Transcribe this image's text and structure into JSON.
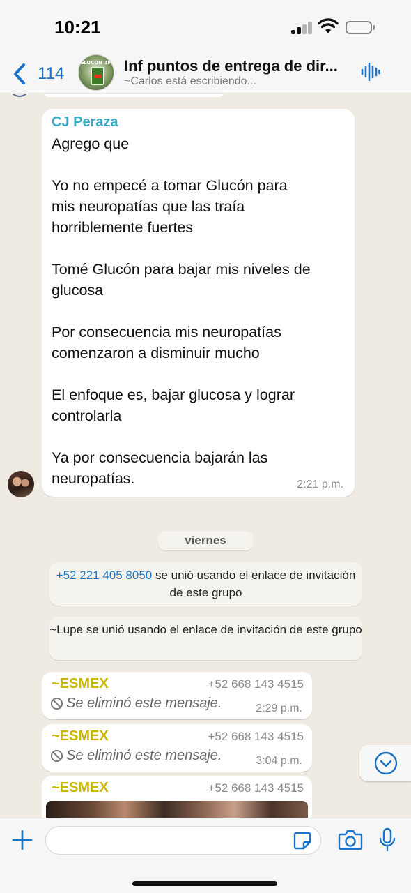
{
  "status_bar": {
    "time": "10:21"
  },
  "header": {
    "back_count": "114",
    "title": "Inf puntos de entrega de dir...",
    "subtitle": "~Carlos está escribiendo...",
    "avatar_label": "GLUCON 1M"
  },
  "messages": {
    "cj": {
      "sender": "CJ Peraza",
      "text": "Agrego que\n\nYo no empecé a tomar Glucón para\nmis neuropatías que las traía\nhorriblemente fuertes\n\nTomé Glucón para bajar mis niveles de\nglucosa\n\nPor consecuencia mis neuropatías\ncomenzaron a disminuir mucho\n\nEl enfoque es, bajar glucosa y lograr\ncontrolarla\n\nYa por consecuencia bajarán las\nneuropatías.",
      "time": "2:21 p.m."
    },
    "day_separator": "viernes",
    "system_1": {
      "phone": "+52 221 405 8050",
      "text": " se unió usando el enlace de invitación de este grupo"
    },
    "system_2": {
      "text": "~Lupe se unió usando el enlace de invitación de este grupo"
    },
    "esmex": [
      {
        "name": "~ESMEX",
        "phone": "+52 668 143 4515",
        "text": "Se eliminó este mensaje.",
        "time": "2:29 p.m."
      },
      {
        "name": "~ESMEX",
        "phone": "+52 668 143 4515",
        "text": "Se eliminó este mensaje.",
        "time": "3:04 p.m."
      },
      {
        "name": "~ESMEX",
        "phone": "+52 668 143 4515"
      }
    ]
  },
  "colors": {
    "link_blue": "#1a73c8",
    "sender_cj": "#35aac3",
    "sender_esmex": "#cbb800",
    "chat_bg": "#efeae2"
  },
  "icons": [
    "chevron-left-icon",
    "voice-wave-icon",
    "ban-icon",
    "chevron-down-icon",
    "plus-icon",
    "sticker-icon",
    "camera-icon",
    "mic-icon"
  ]
}
